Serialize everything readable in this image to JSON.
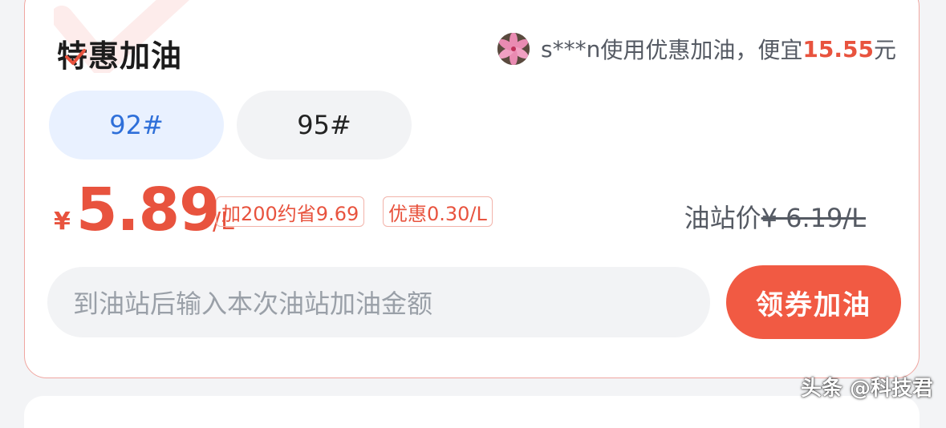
{
  "card": {
    "title": "特惠加油",
    "promo": {
      "user": "s***n",
      "text_before": "使用优惠加油，便宜",
      "amount": "15.55",
      "text_after": "元"
    },
    "tabs": [
      {
        "label": "92#",
        "selected": true
      },
      {
        "label": "95#",
        "selected": false
      }
    ],
    "price": {
      "currency": "¥",
      "value": "5.89",
      "unit": "/L"
    },
    "badges": [
      {
        "label": "加200约省9.69"
      },
      {
        "label": "优惠0.30/L"
      }
    ],
    "station_price": {
      "label": "油站价",
      "value": "¥ 6.19/L"
    },
    "amount_input": {
      "placeholder": "到油站后输入本次油站加油金额"
    },
    "coupon_button": {
      "label": "领券加油"
    }
  },
  "watermark": {
    "text": "头条 @科技君"
  },
  "colors": {
    "accent": "#f15a43",
    "price_red": "#e8533e",
    "tab_selected_bg": "#e9f1ff",
    "tab_selected_text": "#2e6fd9",
    "card_border": "#f0a6a0"
  }
}
